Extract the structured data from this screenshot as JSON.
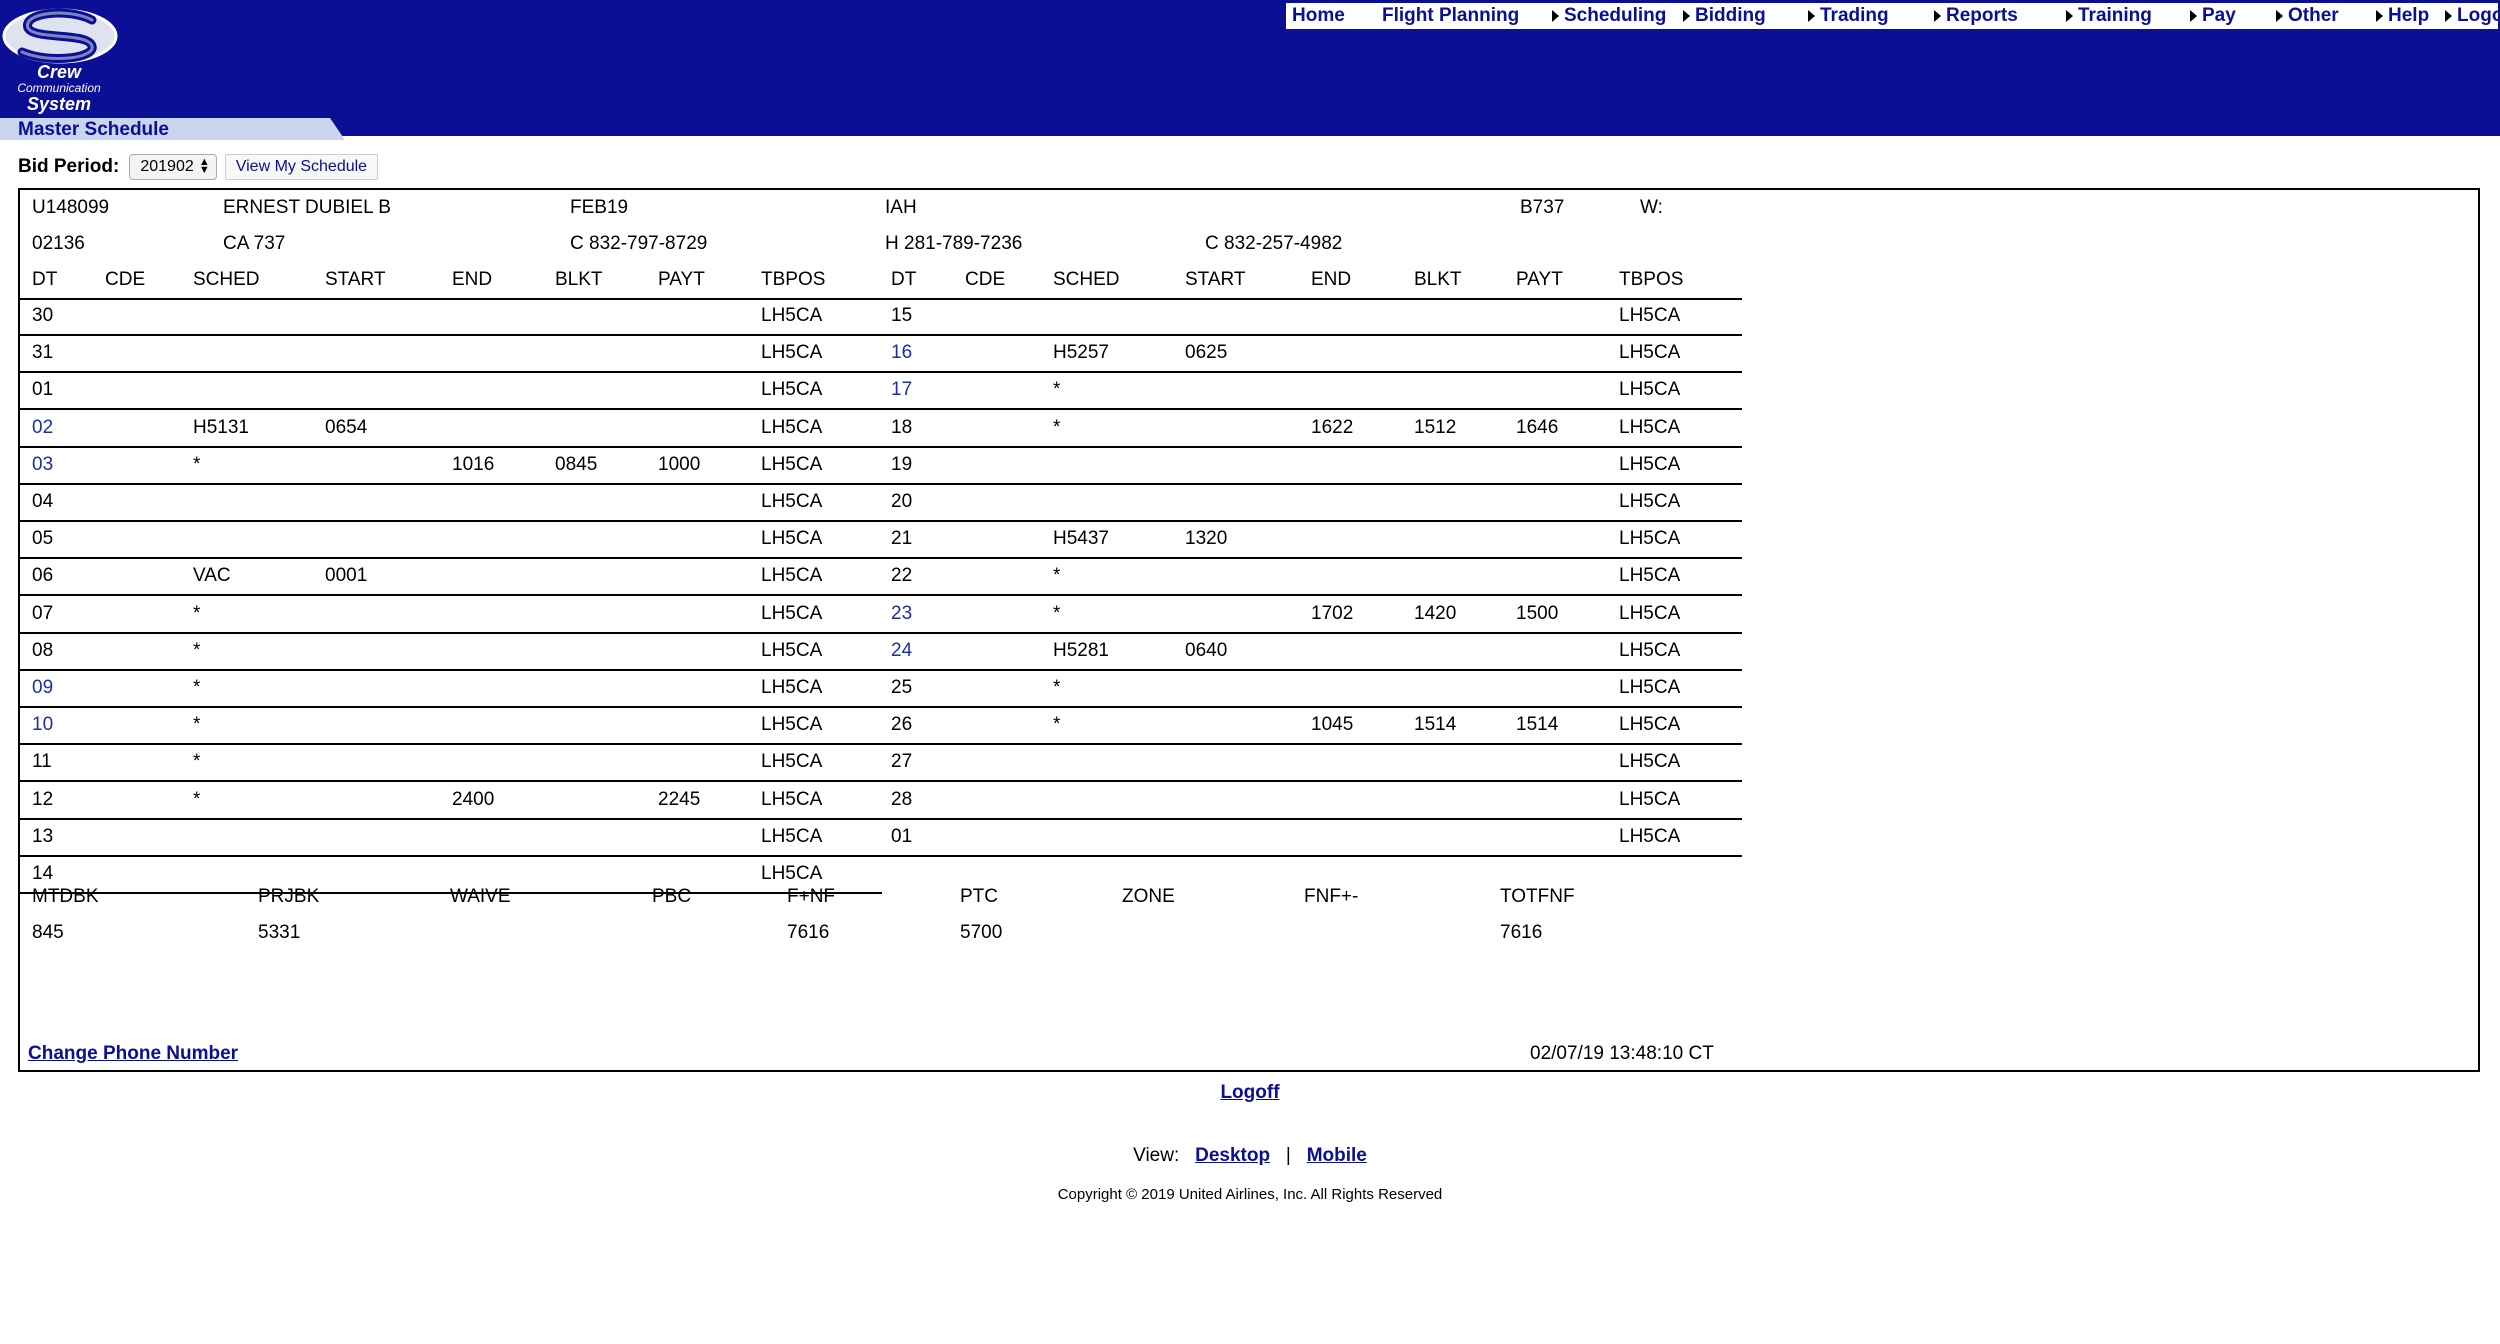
{
  "app": {
    "logo": {
      "line1": "Crew",
      "line2": "Communication",
      "line3": "System"
    },
    "nav": [
      {
        "label": "Home",
        "arrow": false
      },
      {
        "label": "Flight Planning",
        "arrow": false
      },
      {
        "label": "Scheduling",
        "arrow": true
      },
      {
        "label": "Bidding",
        "arrow": true
      },
      {
        "label": "Trading",
        "arrow": true
      },
      {
        "label": "Reports",
        "arrow": true
      },
      {
        "label": "Training",
        "arrow": true
      },
      {
        "label": "Pay",
        "arrow": true
      },
      {
        "label": "Other",
        "arrow": true
      },
      {
        "label": "Help",
        "arrow": true
      },
      {
        "label": "Logout",
        "arrow": true
      }
    ],
    "page_title": "Master Schedule"
  },
  "bid": {
    "label": "Bid Period:",
    "selected": "201902",
    "view_button": "View My Schedule"
  },
  "crew": {
    "id": "U148099",
    "name": "ERNEST DUBIEL B",
    "month": "FEB19",
    "base": "IAH",
    "equipment": "B737",
    "w_label": "W:",
    "emp_no": "02136",
    "position": "CA 737",
    "phone_c1": "C 832-797-8729",
    "phone_h": "H 281-789-7236",
    "phone_c2": "C 832-257-4982"
  },
  "table": {
    "headers": [
      "DT",
      "CDE",
      "SCHED",
      "START",
      "END",
      "BLKT",
      "PAYT",
      "TBPOS"
    ],
    "left_rows": [
      {
        "dt": "30",
        "blue": false,
        "cde": "",
        "sched": "",
        "start": "",
        "end": "",
        "blkt": "",
        "payt": "",
        "tbpos": "LH5CA"
      },
      {
        "dt": "31",
        "blue": false,
        "cde": "",
        "sched": "",
        "start": "",
        "end": "",
        "blkt": "",
        "payt": "",
        "tbpos": "LH5CA"
      },
      {
        "dt": "01",
        "blue": false,
        "cde": "",
        "sched": "",
        "start": "",
        "end": "",
        "blkt": "",
        "payt": "",
        "tbpos": "LH5CA"
      },
      {
        "dt": "02",
        "blue": true,
        "cde": "",
        "sched": "H5131",
        "start": "0654",
        "end": "",
        "blkt": "",
        "payt": "",
        "tbpos": "LH5CA"
      },
      {
        "dt": "03",
        "blue": true,
        "cde": "",
        "sched": "*",
        "start": "",
        "end": "1016",
        "blkt": "0845",
        "payt": "1000",
        "tbpos": "LH5CA"
      },
      {
        "dt": "04",
        "blue": false,
        "cde": "",
        "sched": "",
        "start": "",
        "end": "",
        "blkt": "",
        "payt": "",
        "tbpos": "LH5CA"
      },
      {
        "dt": "05",
        "blue": false,
        "cde": "",
        "sched": "",
        "start": "",
        "end": "",
        "blkt": "",
        "payt": "",
        "tbpos": "LH5CA"
      },
      {
        "dt": "06",
        "blue": false,
        "cde": "",
        "sched": "VAC",
        "start": "0001",
        "end": "",
        "blkt": "",
        "payt": "",
        "tbpos": "LH5CA"
      },
      {
        "dt": "07",
        "blue": false,
        "cde": "",
        "sched": "*",
        "start": "",
        "end": "",
        "blkt": "",
        "payt": "",
        "tbpos": "LH5CA"
      },
      {
        "dt": "08",
        "blue": false,
        "cde": "",
        "sched": "*",
        "start": "",
        "end": "",
        "blkt": "",
        "payt": "",
        "tbpos": "LH5CA"
      },
      {
        "dt": "09",
        "blue": true,
        "cde": "",
        "sched": "*",
        "start": "",
        "end": "",
        "blkt": "",
        "payt": "",
        "tbpos": "LH5CA"
      },
      {
        "dt": "10",
        "blue": true,
        "cde": "",
        "sched": "*",
        "start": "",
        "end": "",
        "blkt": "",
        "payt": "",
        "tbpos": "LH5CA"
      },
      {
        "dt": "11",
        "blue": false,
        "cde": "",
        "sched": "*",
        "start": "",
        "end": "",
        "blkt": "",
        "payt": "",
        "tbpos": "LH5CA"
      },
      {
        "dt": "12",
        "blue": false,
        "cde": "",
        "sched": "*",
        "start": "",
        "end": "2400",
        "blkt": "",
        "payt": "2245",
        "tbpos": "LH5CA"
      },
      {
        "dt": "13",
        "blue": false,
        "cde": "",
        "sched": "",
        "start": "",
        "end": "",
        "blkt": "",
        "payt": "",
        "tbpos": "LH5CA"
      },
      {
        "dt": "14",
        "blue": false,
        "cde": "",
        "sched": "",
        "start": "",
        "end": "",
        "blkt": "",
        "payt": "",
        "tbpos": "LH5CA"
      }
    ],
    "right_rows": [
      {
        "dt": "15",
        "blue": false,
        "cde": "",
        "sched": "",
        "start": "",
        "end": "",
        "blkt": "",
        "payt": "",
        "tbpos": "LH5CA"
      },
      {
        "dt": "16",
        "blue": true,
        "cde": "",
        "sched": "H5257",
        "start": "0625",
        "end": "",
        "blkt": "",
        "payt": "",
        "tbpos": "LH5CA"
      },
      {
        "dt": "17",
        "blue": true,
        "cde": "",
        "sched": "*",
        "start": "",
        "end": "",
        "blkt": "",
        "payt": "",
        "tbpos": "LH5CA"
      },
      {
        "dt": "18",
        "blue": false,
        "cde": "",
        "sched": "*",
        "start": "",
        "end": "1622",
        "blkt": "1512",
        "payt": "1646",
        "tbpos": "LH5CA"
      },
      {
        "dt": "19",
        "blue": false,
        "cde": "",
        "sched": "",
        "start": "",
        "end": "",
        "blkt": "",
        "payt": "",
        "tbpos": "LH5CA"
      },
      {
        "dt": "20",
        "blue": false,
        "cde": "",
        "sched": "",
        "start": "",
        "end": "",
        "blkt": "",
        "payt": "",
        "tbpos": "LH5CA"
      },
      {
        "dt": "21",
        "blue": false,
        "cde": "",
        "sched": "H5437",
        "start": "1320",
        "end": "",
        "blkt": "",
        "payt": "",
        "tbpos": "LH5CA"
      },
      {
        "dt": "22",
        "blue": false,
        "cde": "",
        "sched": "*",
        "start": "",
        "end": "",
        "blkt": "",
        "payt": "",
        "tbpos": "LH5CA"
      },
      {
        "dt": "23",
        "blue": true,
        "cde": "",
        "sched": "*",
        "start": "",
        "end": "1702",
        "blkt": "1420",
        "payt": "1500",
        "tbpos": "LH5CA"
      },
      {
        "dt": "24",
        "blue": true,
        "cde": "",
        "sched": "H5281",
        "start": "0640",
        "end": "",
        "blkt": "",
        "payt": "",
        "tbpos": "LH5CA"
      },
      {
        "dt": "25",
        "blue": false,
        "cde": "",
        "sched": "*",
        "start": "",
        "end": "",
        "blkt": "",
        "payt": "",
        "tbpos": "LH5CA"
      },
      {
        "dt": "26",
        "blue": false,
        "cde": "",
        "sched": "*",
        "start": "",
        "end": "1045",
        "blkt": "1514",
        "payt": "1514",
        "tbpos": "LH5CA"
      },
      {
        "dt": "27",
        "blue": false,
        "cde": "",
        "sched": "",
        "start": "",
        "end": "",
        "blkt": "",
        "payt": "",
        "tbpos": "LH5CA"
      },
      {
        "dt": "28",
        "blue": false,
        "cde": "",
        "sched": "",
        "start": "",
        "end": "",
        "blkt": "",
        "payt": "",
        "tbpos": "LH5CA"
      },
      {
        "dt": "01",
        "blue": false,
        "cde": "",
        "sched": "",
        "start": "",
        "end": "",
        "blkt": "",
        "payt": "",
        "tbpos": "LH5CA"
      }
    ]
  },
  "totals": {
    "labels": [
      "MTDBK",
      "PRJBK",
      "WAIVE",
      "PBC",
      "F+NF",
      "PTC",
      "ZONE",
      "FNF+-",
      "TOTFNF"
    ],
    "values": [
      "845",
      "5331",
      "",
      "",
      "7616",
      "5700",
      "",
      "",
      "7616"
    ]
  },
  "footer": {
    "change_phone": "Change Phone Number",
    "timestamp": "02/07/19 13:48:10 CT",
    "logoff": "Logoff",
    "view_label": "View:",
    "desktop": "Desktop",
    "separator": "|",
    "mobile": "Mobile",
    "copyright": "Copyright © 2019 United Airlines, Inc. All Rights Reserved"
  },
  "colors": {
    "header_bg": "#0a0f96",
    "link": "#0a0f96",
    "date_blue": "#1a2fa8",
    "title_bar": "#c9d4ee"
  }
}
